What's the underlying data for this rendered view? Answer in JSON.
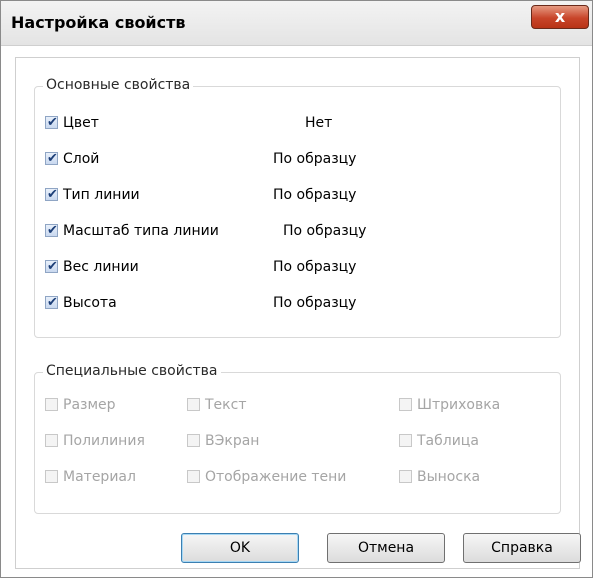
{
  "window": {
    "title": "Настройка свойств",
    "close_glyph": "x"
  },
  "basic": {
    "title": "Основные свойства",
    "items": [
      {
        "label": "Цвет",
        "value": "Нет",
        "checked": true
      },
      {
        "label": "Слой",
        "value": "По образцу",
        "checked": true
      },
      {
        "label": "Тип линии",
        "value": "По образцу",
        "checked": true
      },
      {
        "label": "Масштаб типа линии",
        "value": "По образцу",
        "checked": true
      },
      {
        "label": "Вес линии",
        "value": "По образцу",
        "checked": true
      },
      {
        "label": "Высота",
        "value": "По образцу",
        "checked": true
      }
    ]
  },
  "special": {
    "title": "Специальные свойства",
    "items": [
      {
        "label": "Размер",
        "checked": false,
        "enabled": false
      },
      {
        "label": "Текст",
        "checked": false,
        "enabled": false
      },
      {
        "label": "Штриховка",
        "checked": false,
        "enabled": false
      },
      {
        "label": "Полилиния",
        "checked": false,
        "enabled": false
      },
      {
        "label": "ВЭкран",
        "checked": false,
        "enabled": false
      },
      {
        "label": "Таблица",
        "checked": false,
        "enabled": false
      },
      {
        "label": "Материал",
        "checked": false,
        "enabled": false
      },
      {
        "label": "Отображение тени",
        "checked": false,
        "enabled": false
      },
      {
        "label": "Выноска",
        "checked": false,
        "enabled": false
      }
    ]
  },
  "buttons": {
    "ok": "OK",
    "cancel": "Отмена",
    "help": "Справка"
  },
  "colors": {
    "close_button": "#c8452a",
    "default_button_border": "#3c7fb1"
  }
}
